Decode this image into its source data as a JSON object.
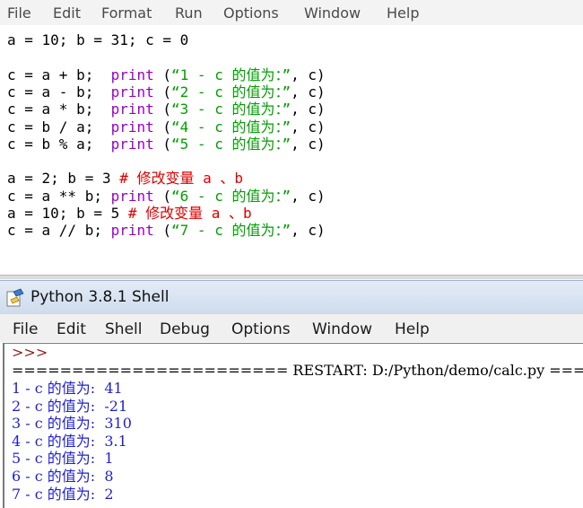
{
  "editor_menu": {
    "file": "File",
    "edit": "Edit",
    "format": "Format",
    "run": "Run",
    "options": "Options",
    "window": "Window",
    "help": "Help"
  },
  "editor_code": [
    {
      "id": "l1",
      "parts": [
        {
          "t": "a = 10; b = 31; c = 0",
          "c": "plain"
        }
      ]
    },
    {
      "id": "l2",
      "parts": []
    },
    {
      "id": "l3",
      "parts": [
        {
          "t": "c = a + b;  ",
          "c": "plain"
        },
        {
          "t": "print",
          "c": "kw"
        },
        {
          "t": " (",
          "c": "plain"
        },
        {
          "t": "“1 - c 的值为：”",
          "c": "str"
        },
        {
          "t": ", c)",
          "c": "plain"
        }
      ]
    },
    {
      "id": "l4",
      "parts": [
        {
          "t": "c = a - b;  ",
          "c": "plain"
        },
        {
          "t": "print",
          "c": "kw"
        },
        {
          "t": " (",
          "c": "plain"
        },
        {
          "t": "“2 - c 的值为：”",
          "c": "str"
        },
        {
          "t": ", c)",
          "c": "plain"
        }
      ]
    },
    {
      "id": "l5",
      "parts": [
        {
          "t": "c = a * b;  ",
          "c": "plain"
        },
        {
          "t": "print",
          "c": "kw"
        },
        {
          "t": " (",
          "c": "plain"
        },
        {
          "t": "“3 - c 的值为：”",
          "c": "str"
        },
        {
          "t": ", c)",
          "c": "plain"
        }
      ]
    },
    {
      "id": "l6",
      "parts": [
        {
          "t": "c = b / a;  ",
          "c": "plain"
        },
        {
          "t": "print",
          "c": "kw"
        },
        {
          "t": " (",
          "c": "plain"
        },
        {
          "t": "“4 - c 的值为：”",
          "c": "str"
        },
        {
          "t": ", c)",
          "c": "plain"
        }
      ]
    },
    {
      "id": "l7",
      "parts": [
        {
          "t": "c = b % a;  ",
          "c": "plain"
        },
        {
          "t": "print",
          "c": "kw"
        },
        {
          "t": " (",
          "c": "plain"
        },
        {
          "t": "“5 - c 的值为：”",
          "c": "str"
        },
        {
          "t": ", c)",
          "c": "plain"
        }
      ]
    },
    {
      "id": "l8",
      "parts": []
    },
    {
      "id": "l9",
      "parts": [
        {
          "t": "a = 2; b = 3 ",
          "c": "plain"
        },
        {
          "t": "# 修改变量 a 、b",
          "c": "cmt"
        }
      ]
    },
    {
      "id": "l10",
      "parts": [
        {
          "t": "c = a ** b; ",
          "c": "plain"
        },
        {
          "t": "print",
          "c": "kw"
        },
        {
          "t": " (",
          "c": "plain"
        },
        {
          "t": "“6 - c 的值为：”",
          "c": "str"
        },
        {
          "t": ", c)",
          "c": "plain"
        }
      ]
    },
    {
      "id": "l11",
      "parts": [
        {
          "t": "a = 10; b = 5 ",
          "c": "plain"
        },
        {
          "t": "# 修改变量 a 、b",
          "c": "cmt"
        }
      ]
    },
    {
      "id": "l12",
      "parts": [
        {
          "t": "c = a // b; ",
          "c": "plain"
        },
        {
          "t": "print",
          "c": "kw"
        },
        {
          "t": " (",
          "c": "plain"
        },
        {
          "t": "“7 - c 的值为：”",
          "c": "str"
        },
        {
          "t": ", c)",
          "c": "plain"
        }
      ]
    }
  ],
  "shell_window": {
    "title": "Python 3.8.1 Shell"
  },
  "shell_menu": {
    "file": "File",
    "edit": "Edit",
    "shell": "Shell",
    "debug": "Debug",
    "options": "Options",
    "window": "Window",
    "help": "Help"
  },
  "shell_output": {
    "prompt": ">>>",
    "restart": "======================= RESTART: D:/Python/demo/calc.py ====",
    "results": [
      "1 - c 的值为:  41",
      "2 - c 的值为:  -21",
      "3 - c 的值为:  310",
      "4 - c 的值为:  3.1",
      "5 - c 的值为:  1",
      "6 - c 的值为:  8",
      "7 - c 的值为:  2"
    ]
  },
  "colors": {
    "keyword": "#9c00c8",
    "string": "#00a000",
    "comment": "#dd0000",
    "output": "#1f1fd2",
    "prompt": "#8b1a1a"
  }
}
